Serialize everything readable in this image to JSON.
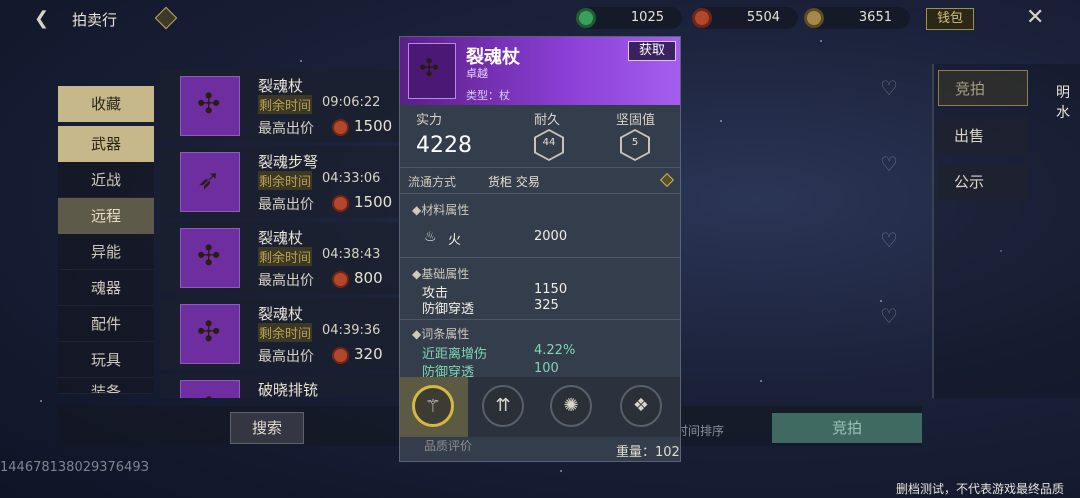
{
  "header": {
    "title": "拍卖行"
  },
  "currency": [
    {
      "value": "1025",
      "color": "#3aa05c"
    },
    {
      "value": "5504",
      "color": "#b4462b"
    },
    {
      "value": "3651",
      "color": "#a6884a"
    }
  ],
  "wallet": "钱包",
  "left_menu": {
    "favorites": "收藏",
    "weapons": "武器",
    "subs": [
      "近战",
      "远程",
      "异能",
      "魂器",
      "配件",
      "玩具",
      "装备"
    ]
  },
  "items": [
    {
      "name": "裂魂杖",
      "time_label": "剩余时间",
      "time": "09:06:22",
      "bid_label": "最高出价",
      "bid": "1500"
    },
    {
      "name": "裂魂步弩",
      "time_label": "剩余时间",
      "time": "04:33:06",
      "bid_label": "最高出价",
      "bid": "1500"
    },
    {
      "name": "裂魂杖",
      "time_label": "剩余时间",
      "time": "04:38:43",
      "bid_label": "最高出价",
      "bid": "800"
    },
    {
      "name": "裂魂杖",
      "time_label": "剩余时间",
      "time": "04:39:36",
      "bid_label": "最高出价",
      "bid": "320"
    },
    {
      "name": "破晓排铳"
    }
  ],
  "right_tabs": [
    "竞拍",
    "出售",
    "公示"
  ],
  "right_cut_text": "明水",
  "bottom": {
    "search": "搜索",
    "sort": "时间排序",
    "bid": "竞拍"
  },
  "uid": "14467813802937649З",
  "notice": "删档测试，不代表游戏最终品质",
  "popup": {
    "name": "裂魂杖",
    "quality": "卓越",
    "type": "类型：杖",
    "get": "获取",
    "power_label": "实力",
    "power": "4228",
    "durability_label": "耐久",
    "durability": "44",
    "solidity_label": "坚固值",
    "solidity": "5",
    "circulation_label": "流通方式",
    "circulation": "货柜 交易",
    "material_title": "材料属性",
    "material": [
      {
        "k": "火",
        "v": "2000"
      }
    ],
    "base_title": "基础属性",
    "base": [
      {
        "k": "攻击",
        "v": "1150"
      },
      {
        "k": "防御穿透",
        "v": "325"
      }
    ],
    "affix_title": "词条属性",
    "affix": [
      {
        "k": "近距离增伤",
        "v": "4.22%"
      },
      {
        "k": "防御穿透",
        "v": "100"
      }
    ],
    "cut_text": "品质评价",
    "weight": "重量：102"
  }
}
